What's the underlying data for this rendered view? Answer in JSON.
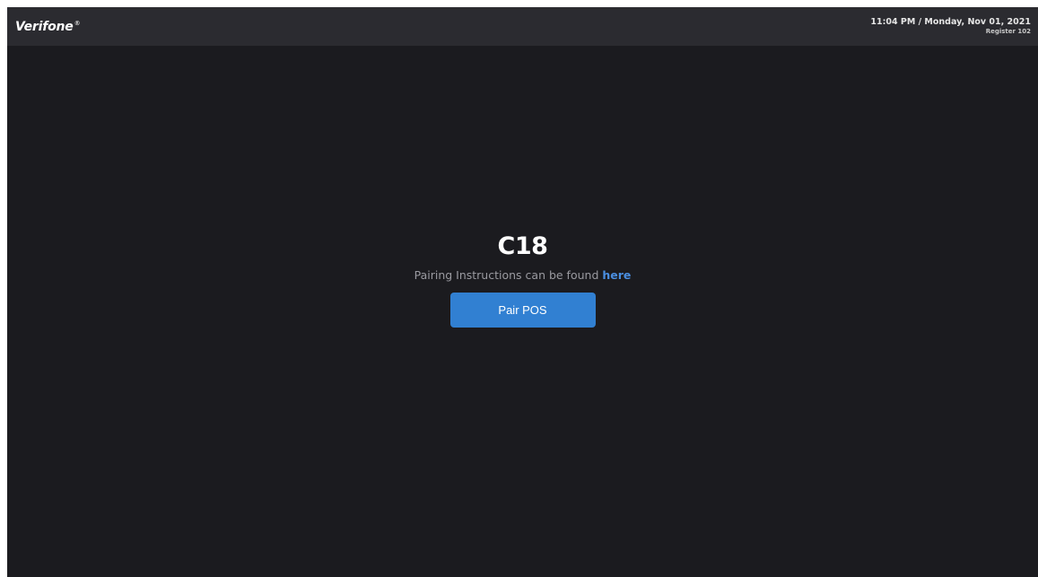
{
  "header": {
    "logo": "Verifone",
    "logo_mark": "®",
    "datetime": "11:04 PM / Monday, Nov 01, 2021",
    "register": "Register 102"
  },
  "main": {
    "device_id": "C18",
    "instructions_text": "Pairing Instructions can be found ",
    "instructions_link": "here",
    "pair_button_label": "Pair POS"
  },
  "colors": {
    "background": "#1b1b1f",
    "header_background": "#2b2b30",
    "accent": "#3180d2",
    "link": "#4a8ee0"
  }
}
